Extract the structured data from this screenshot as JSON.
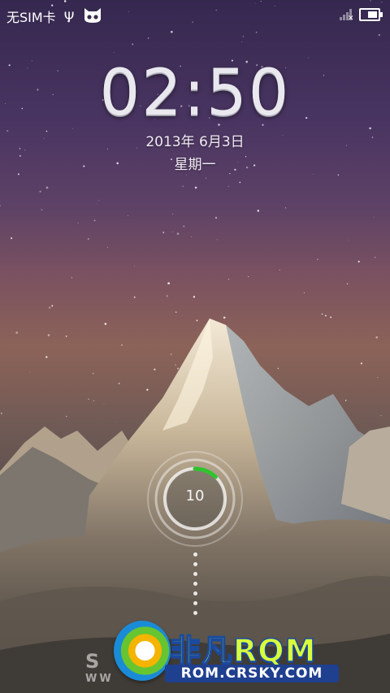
{
  "status_bar": {
    "carrier": "无SIM卡",
    "usb_icon": "usb-icon",
    "cyanogen_icon": "cyanogenmod-icon",
    "signal_icon": "no-signal-icon",
    "battery_icon": "battery-icon",
    "battery_level": 0.5
  },
  "lockscreen": {
    "time": "02:50",
    "date": "2013年 6月3日",
    "weekday": "星期一",
    "unlock_countdown": "10",
    "unlock_progress": 0.12,
    "accent_color": "#2fc42f"
  },
  "watermark": {
    "title": "非凡RQM",
    "url": "ROM.CRSKY.COM",
    "left_text": "S",
    "left_small": "WW"
  }
}
